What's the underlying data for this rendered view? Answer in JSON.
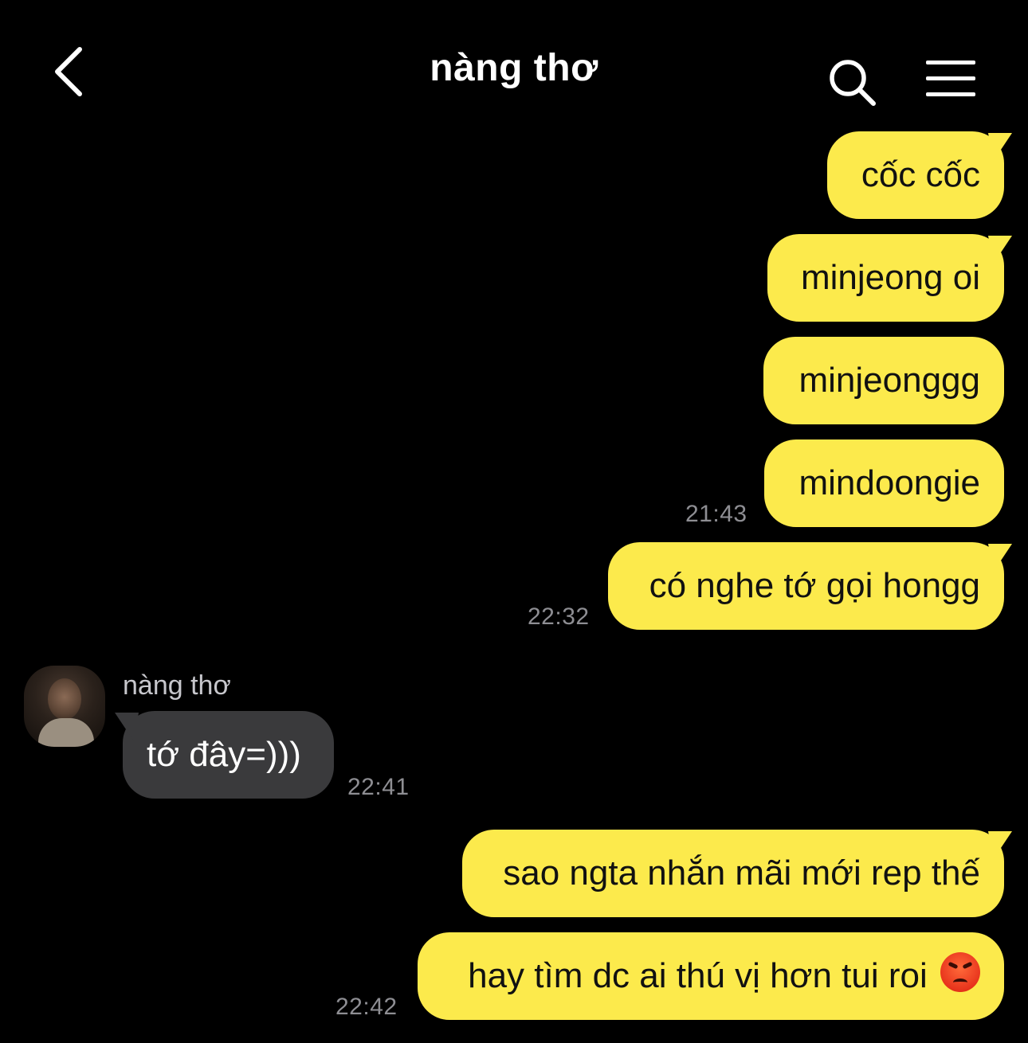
{
  "header": {
    "title": "nàng thơ",
    "back_icon": "chevron-left-icon",
    "search_icon": "search-icon",
    "menu_icon": "hamburger-menu-icon"
  },
  "colors": {
    "background": "#000000",
    "outgoing_bubble": "#fcea4c",
    "incoming_bubble": "#3a3a3c",
    "timestamp": "#8e8e93"
  },
  "messages": {
    "m1": {
      "text": "cốc cốc"
    },
    "m2": {
      "text": "minjeong oi"
    },
    "m3": {
      "text": "minjeonggg"
    },
    "m4": {
      "text": "mindoongie",
      "time": "21:43"
    },
    "m5": {
      "text": "có nghe tớ gọi hongg",
      "time": "22:32"
    },
    "m6": {
      "sender": "nàng thơ",
      "text": "tớ đây=)))",
      "time": "22:41"
    },
    "m7": {
      "text": "sao ngta nhắn mãi mới rep thế"
    },
    "m8": {
      "text": "hay tìm dc ai thú vị hơn tui roi",
      "emoji": "angry-face-emoji",
      "time": "22:42"
    }
  }
}
